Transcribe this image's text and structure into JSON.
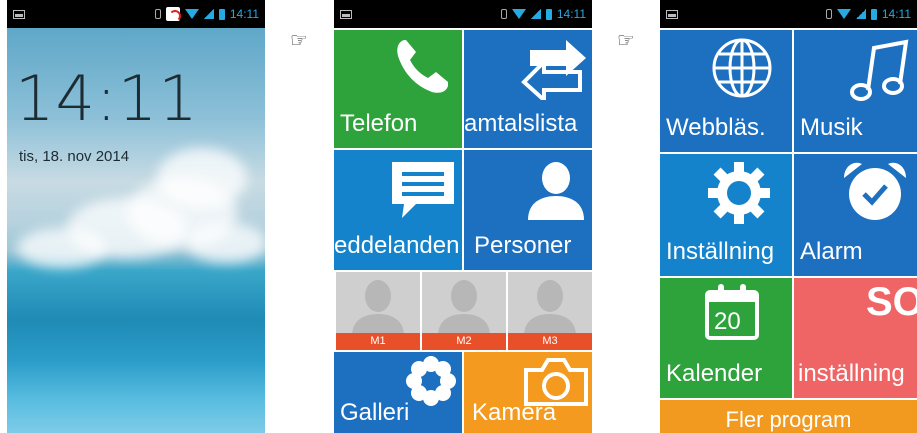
{
  "lock_screen": {
    "status_time": "14:11",
    "clock": "14:11",
    "date": "tis, 18. nov 2014"
  },
  "home_screen_1": {
    "status_time": "14:11",
    "tiles": {
      "phone": "Telefon",
      "call_log": "amtalslista",
      "messages": "eddelanden",
      "contacts": "Personer",
      "gallery": "Galleri",
      "camera": "Kamera"
    },
    "speed_dial": [
      "M1",
      "M2",
      "M3"
    ]
  },
  "home_screen_2": {
    "status_time": "14:11",
    "tiles": {
      "browser": "Webbläs.",
      "music": "Musik",
      "settings": "Inställning",
      "alarm": "Alarm",
      "calendar": "Kalender",
      "calendar_day": "20",
      "sos_title": "SOS",
      "sos_settings": "inställning"
    },
    "more_apps": "Fler program"
  },
  "colors": {
    "green": "#2ea33c",
    "blue": "#1d6fc0",
    "light_blue": "#1483cc",
    "orange": "#f39a1f",
    "contact_bar": "#e8502a",
    "sos": "#ef6565"
  },
  "icons": [
    "pointing-hand-icon",
    "phone-icon",
    "swap-arrows-icon",
    "message-icon",
    "person-icon",
    "flower-icon",
    "camera-icon",
    "globe-icon",
    "music-note-icon",
    "gear-icon",
    "alarm-clock-icon",
    "calendar-icon"
  ]
}
